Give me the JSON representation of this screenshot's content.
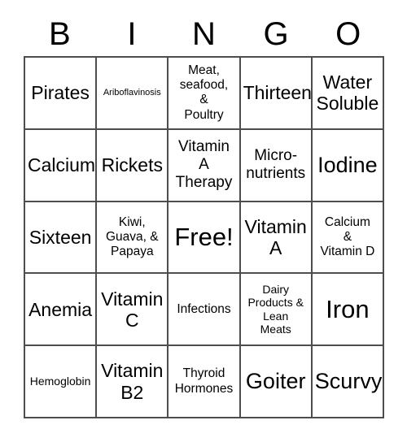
{
  "card": {
    "title": "BINGO",
    "header_letters": [
      "B",
      "I",
      "N",
      "G",
      "O"
    ],
    "grid_line_color": "#4d4d4d",
    "background_color": "#ffffff",
    "text_color": "#000000",
    "rows": 5,
    "columns": 5,
    "free_space": {
      "row": 3,
      "column": 3,
      "label": "Free!"
    },
    "cells": [
      [
        {
          "text": "Pirates",
          "size": "xl"
        },
        {
          "text": "Ariboflavinosis",
          "size": "xs"
        },
        {
          "text": "Meat,\nseafood,\n&\nPoultry",
          "size": "m"
        },
        {
          "text": "Thirteen",
          "size": "xl"
        },
        {
          "text": "Water\nSoluble",
          "size": "xl"
        }
      ],
      [
        {
          "text": "Calcium",
          "size": "xl"
        },
        {
          "text": "Rickets",
          "size": "xl"
        },
        {
          "text": "Vitamin\nA\nTherapy",
          "size": "l"
        },
        {
          "text": "Micro-\nnutrients",
          "size": "l"
        },
        {
          "text": "Iodine",
          "size": "2xl"
        }
      ],
      [
        {
          "text": "Sixteen",
          "size": "xl"
        },
        {
          "text": "Kiwi,\nGuava, &\nPapaya",
          "size": "m"
        },
        {
          "text": "Free!",
          "size": "3xl"
        },
        {
          "text": "Vitamin\nA",
          "size": "xl"
        },
        {
          "text": "Calcium\n&\nVitamin D",
          "size": "m"
        }
      ],
      [
        {
          "text": "Anemia",
          "size": "xl"
        },
        {
          "text": "Vitamin\nC",
          "size": "xl"
        },
        {
          "text": "Infections",
          "size": "m"
        },
        {
          "text": "Dairy\nProducts &\nLean\nMeats",
          "size": "s"
        },
        {
          "text": "Iron",
          "size": "3xl"
        }
      ],
      [
        {
          "text": "Hemoglobin",
          "size": "s"
        },
        {
          "text": "Vitamin\nB2",
          "size": "xl"
        },
        {
          "text": "Thyroid\nHormones",
          "size": "m"
        },
        {
          "text": "Goiter",
          "size": "2xl"
        },
        {
          "text": "Scurvy",
          "size": "2xl"
        }
      ]
    ]
  }
}
